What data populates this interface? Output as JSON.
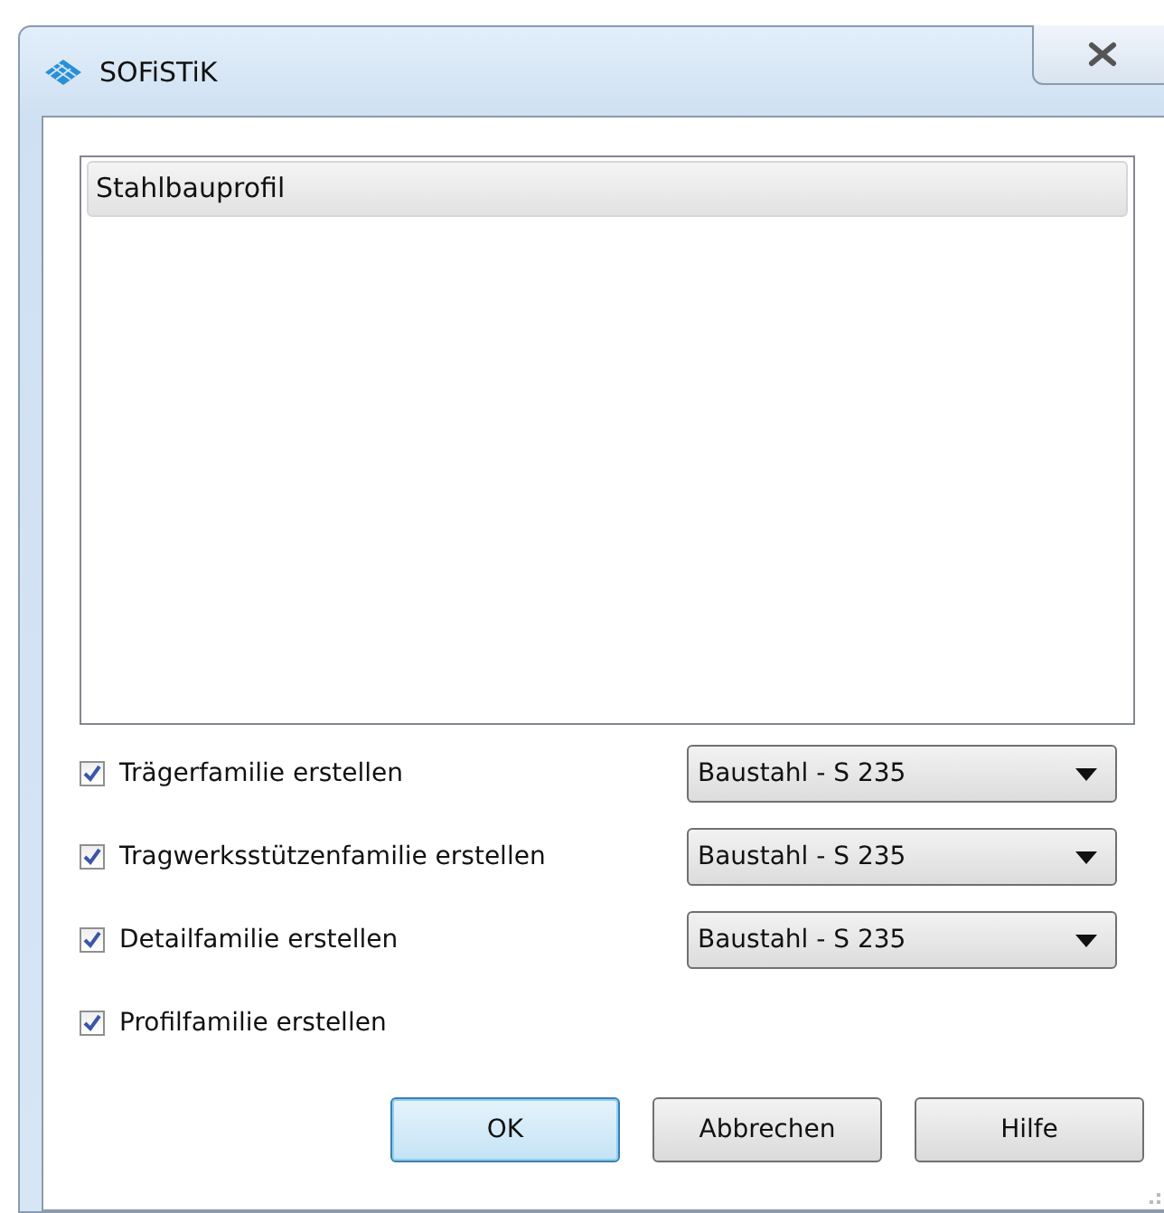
{
  "window": {
    "title": "SOFiSTiK"
  },
  "list": {
    "items": [
      {
        "label": "Stahlbauprofil",
        "selected": true
      }
    ]
  },
  "options": [
    {
      "label": "Trägerfamilie erstellen",
      "checked": true,
      "material": "Baustahl - S 235"
    },
    {
      "label": "Tragwerksstützenfamilie erstellen",
      "checked": true,
      "material": "Baustahl - S 235"
    },
    {
      "label": "Detailfamilie erstellen",
      "checked": true,
      "material": "Baustahl - S 235"
    },
    {
      "label": "Profilfamilie erstellen",
      "checked": true
    }
  ],
  "buttons": [
    {
      "label": "OK",
      "default": true
    },
    {
      "label": "Abbrechen",
      "default": false
    },
    {
      "label": "Hilfe",
      "default": false
    }
  ]
}
